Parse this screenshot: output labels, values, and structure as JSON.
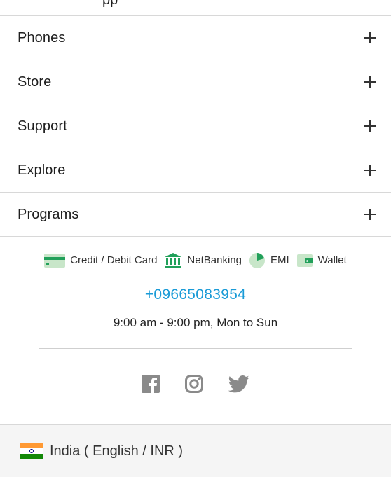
{
  "top_partial": {
    "glyph": "pp"
  },
  "accordion": [
    {
      "label": "Phones"
    },
    {
      "label": "Store"
    },
    {
      "label": "Support"
    },
    {
      "label": "Explore"
    },
    {
      "label": "Programs"
    }
  ],
  "payments": {
    "card": "Credit / Debit Card",
    "netbanking": "NetBanking",
    "emi": "EMI",
    "wallet": "Wallet"
  },
  "contact": {
    "phone": "+09665083954",
    "hours": "9:00 am - 9:00 pm, Mon to Sun"
  },
  "social": [
    "facebook-icon",
    "instagram-icon",
    "twitter-icon"
  ],
  "footer": {
    "locale": "India ( English / INR )"
  },
  "colors": {
    "accent": "#1a9bd7",
    "icon_green": "#21a05a",
    "icon_gray": "#8a8a8a"
  }
}
